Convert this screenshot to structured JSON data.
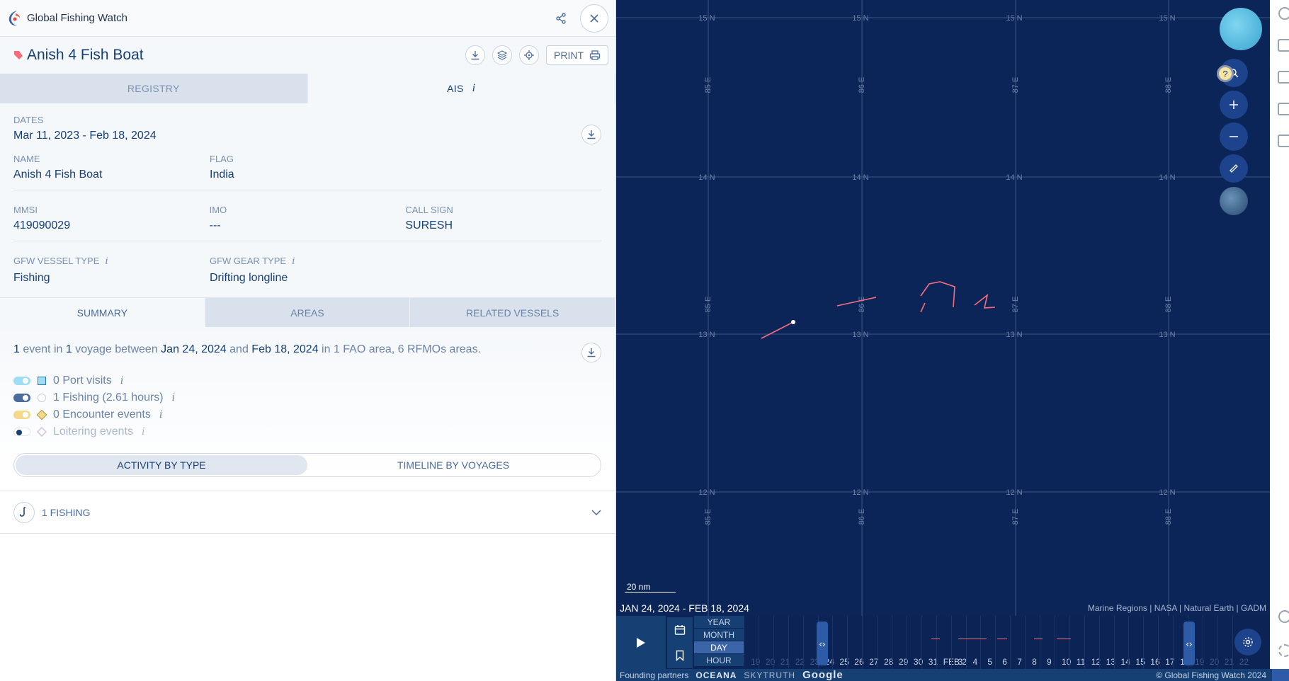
{
  "app": {
    "title": "Global Fishing Watch"
  },
  "vessel": {
    "name": "Anish 4 Fish Boat",
    "print_label": "PRINT"
  },
  "tabs": [
    "REGISTRY",
    "AIS"
  ],
  "info": {
    "dates_label": "DATES",
    "dates_value": "Mar 11, 2023 - Feb 18, 2024",
    "name_label": "NAME",
    "name_value": "Anish 4 Fish Boat",
    "flag_label": "FLAG",
    "flag_value": "India",
    "mmsi_label": "MMSI",
    "mmsi_value": "419090029",
    "imo_label": "IMO",
    "imo_value": "---",
    "callsign_label": "CALL SIGN",
    "callsign_value": "SURESH",
    "vessel_type_label": "GFW VESSEL TYPE",
    "vessel_type_value": "Fishing",
    "gear_type_label": "GFW GEAR TYPE",
    "gear_type_value": "Drifting longline"
  },
  "section_tabs": [
    "SUMMARY",
    "AREAS",
    "RELATED VESSELS"
  ],
  "summary": {
    "p1": "1",
    "p2": " event in ",
    "p3": "1",
    "p4": " voyage between ",
    "p5": "Jan 24, 2024",
    "p6": " and ",
    "p7": "Feb 18, 2024",
    "p8": " in 1 FAO area, 6 RFMOs areas."
  },
  "events": [
    {
      "label": "0 Port visits",
      "color": "#9fdcf5",
      "on": true
    },
    {
      "label": "1 Fishing (2.61 hours)",
      "color": "#4a6d9e",
      "on": true
    },
    {
      "label": "0 Encounter events",
      "color": "#f4d98b",
      "on": true
    },
    {
      "label": "Loitering events",
      "color": "#ffffff",
      "on": false
    }
  ],
  "view_toggle": [
    "ACTIVITY BY TYPE",
    "TIMELINE BY VOYAGES"
  ],
  "fishing_row": "1 FISHING",
  "map": {
    "lat_labels": [
      "15 N",
      "14 N",
      "13 N",
      "12 N"
    ],
    "lon_labels": [
      "85 E",
      "86 E",
      "87 E",
      "88 E"
    ],
    "scale": "20 nm",
    "date_range": "JAN 24, 2024 - FEB 18, 2024",
    "attribution": "Marine Regions | NASA | Natural Earth | GADM",
    "help": "?"
  },
  "timebar": {
    "zooms": [
      "YEAR",
      "MONTH",
      "DAY",
      "HOUR"
    ],
    "active_zoom": "DAY",
    "ticks": [
      "19",
      "20",
      "21",
      "22",
      "23",
      "24",
      "25",
      "26",
      "27",
      "28",
      "29",
      "30",
      "31",
      "FEB 2",
      "3",
      "4",
      "5",
      "6",
      "7",
      "8",
      "9",
      "10",
      "11",
      "12",
      "13",
      "14",
      "15",
      "16",
      "17",
      "18",
      "19",
      "20",
      "21",
      "22"
    ]
  },
  "footer": {
    "partners": "Founding partners",
    "brands": [
      "OCEANA",
      "SKYTRUTH",
      "Google"
    ],
    "copyright": "© Global Fishing Watch 2024"
  },
  "colors": {
    "accent": "#163f74",
    "map_bg": "#0b2559",
    "track": "#f66e7c"
  }
}
